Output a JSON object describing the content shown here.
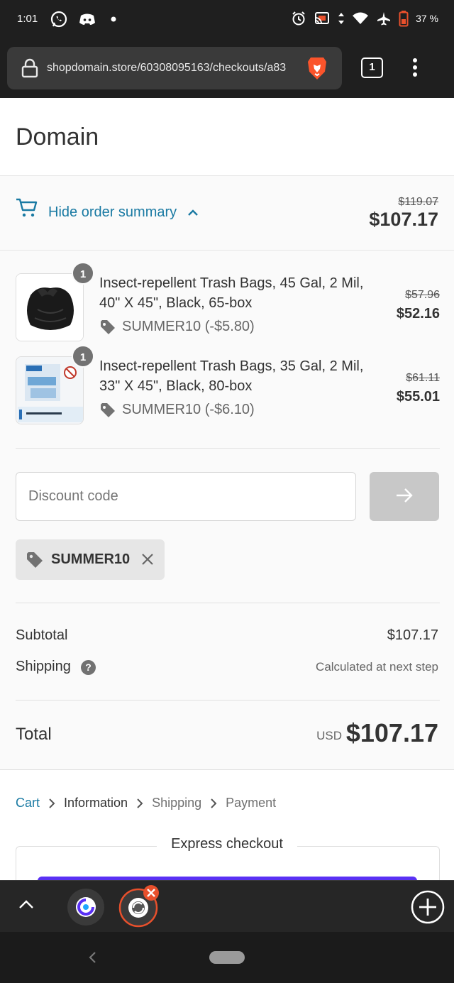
{
  "status_bar": {
    "time": "1:01",
    "battery": "37 %",
    "left_icons": [
      "whatsapp-icon",
      "discord-icon",
      "notification-dot-icon"
    ],
    "right_icons": [
      "alarm-icon",
      "cast-icon",
      "data-arrows-icon",
      "wifi-icon",
      "airplane-icon",
      "battery-icon"
    ]
  },
  "browser": {
    "url": "shopdomain.store/60308095163/checkouts/a83",
    "tab_count": "1"
  },
  "header": {
    "shop_name": "Domain"
  },
  "summary": {
    "toggle_label": "Hide order summary",
    "original_total": "$119.07",
    "total": "$107.17"
  },
  "items": [
    {
      "quantity": "1",
      "title": "Insect-repellent Trash Bags, 45 Gal, 2 Mil, 40\" X 45\", Black, 65-box",
      "discount": "SUMMER10 (-$5.80)",
      "original_price": "$57.96",
      "price": "$52.16"
    },
    {
      "quantity": "1",
      "title": "Insect-repellent Trash Bags, 35 Gal, 2 Mil, 33\" X 45\", Black, 80-box",
      "discount": "SUMMER10 (-$6.10)",
      "original_price": "$61.11",
      "price": "$55.01"
    }
  ],
  "discount_form": {
    "placeholder": "Discount code",
    "applied_code": "SUMMER10"
  },
  "totals": {
    "subtotal_label": "Subtotal",
    "subtotal_value": "$107.17",
    "shipping_label": "Shipping",
    "shipping_value": "Calculated at next step",
    "help_glyph": "?",
    "total_label": "Total",
    "currency": "USD",
    "total_value": "$107.17"
  },
  "breadcrumbs": [
    {
      "label": "Cart",
      "state": "link"
    },
    {
      "label": "Information",
      "state": "current"
    },
    {
      "label": "Shipping",
      "state": "upcoming"
    },
    {
      "label": "Payment",
      "state": "upcoming"
    }
  ],
  "express": {
    "label": "Express checkout"
  },
  "colors": {
    "accent": "#1a7aa3",
    "text": "#333333",
    "express_button": "#5a31f4",
    "close_badge": "#e8502c"
  }
}
